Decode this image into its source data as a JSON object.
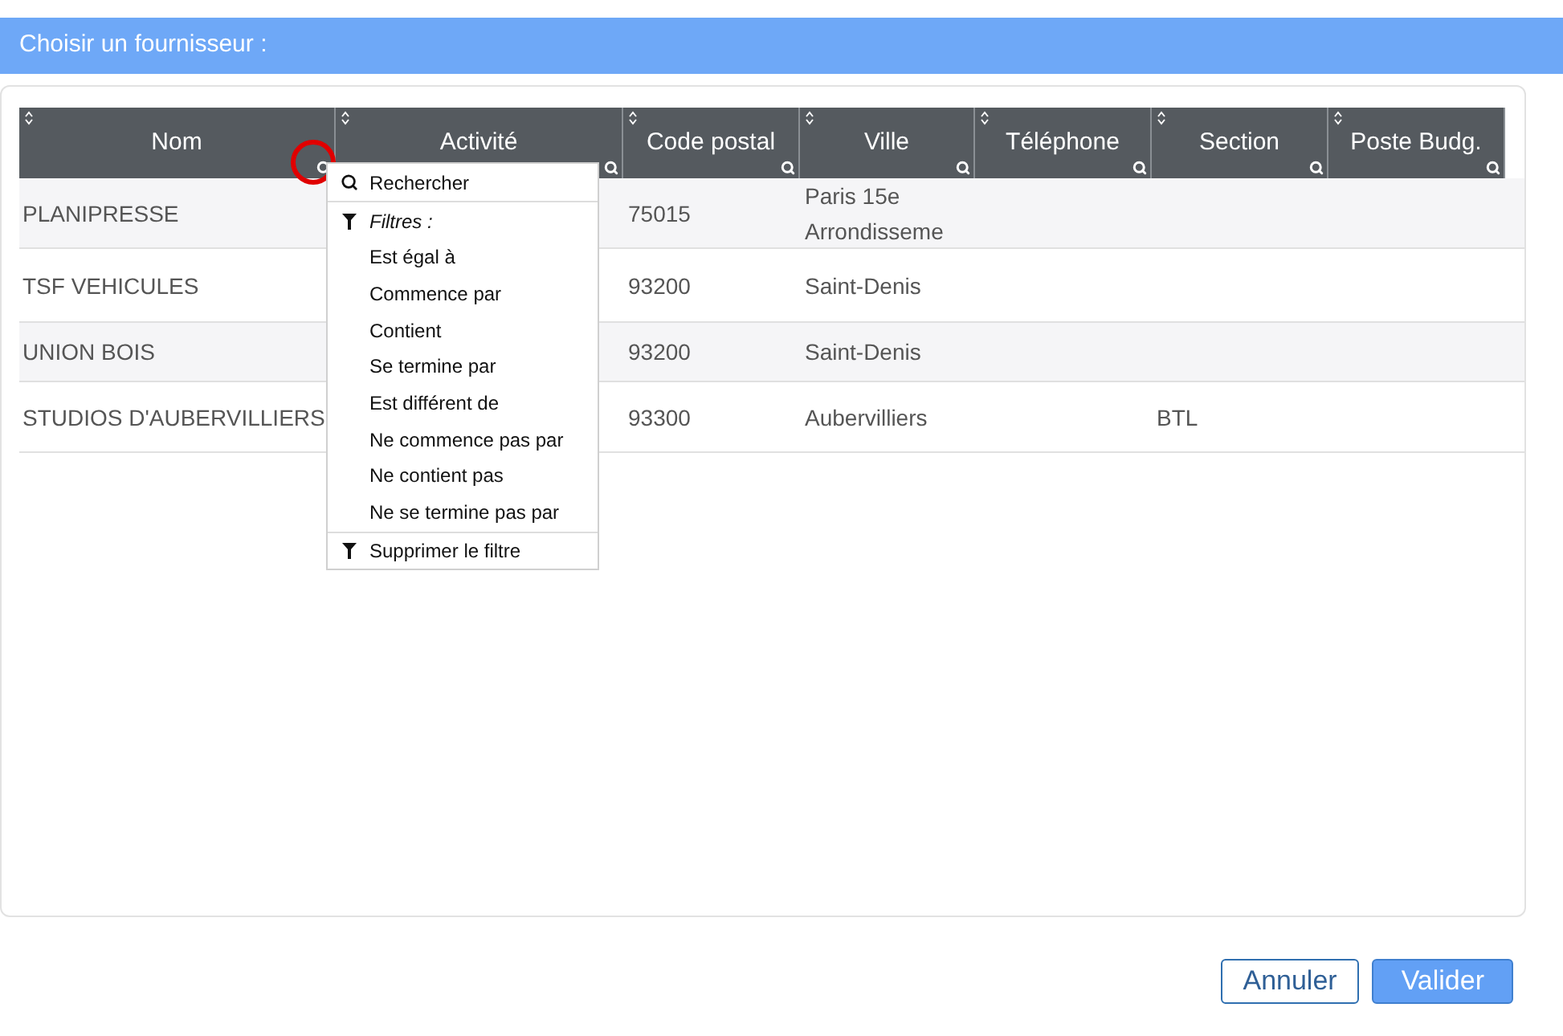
{
  "dialog": {
    "title": "Choisir un fournisseur :"
  },
  "table": {
    "columns": [
      "Nom",
      "Activité",
      "Code postal",
      "Ville",
      "Téléphone",
      "Section",
      "Poste Budg."
    ],
    "rows": [
      {
        "cells": [
          "PLANIPRESSE",
          "",
          "75015",
          "Paris 15e Arrondisseme",
          "",
          "",
          ""
        ]
      },
      {
        "cells": [
          "TSF VEHICULES",
          "",
          "93200",
          "Saint-Denis",
          "",
          "",
          ""
        ]
      },
      {
        "cells": [
          "UNION BOIS",
          "",
          "93200",
          "Saint-Denis",
          "",
          "",
          ""
        ]
      },
      {
        "cells": [
          "STUDIOS D'AUBERVILLIERS",
          "",
          "93300",
          "Aubervilliers",
          "",
          "BTL",
          ""
        ]
      }
    ]
  },
  "filter_menu": {
    "items": [
      {
        "kind": "search",
        "label": "Rechercher"
      },
      {
        "kind": "header",
        "label": "Filtres :"
      },
      {
        "kind": "option",
        "label": "Est égal à"
      },
      {
        "kind": "option",
        "label": "Commence par"
      },
      {
        "kind": "option",
        "label": "Contient"
      },
      {
        "kind": "option",
        "label": "Se termine par"
      },
      {
        "kind": "option",
        "label": "Est différent de"
      },
      {
        "kind": "option",
        "label": "Ne commence pas par"
      },
      {
        "kind": "option",
        "label": "Ne contient pas"
      },
      {
        "kind": "option",
        "label": "Ne se termine pas par"
      },
      {
        "kind": "clear",
        "label": "Supprimer le filtre"
      }
    ]
  },
  "buttons": [
    {
      "kind": "secondary",
      "label": "Annuler"
    },
    {
      "kind": "primary",
      "label": "Valider"
    }
  ]
}
